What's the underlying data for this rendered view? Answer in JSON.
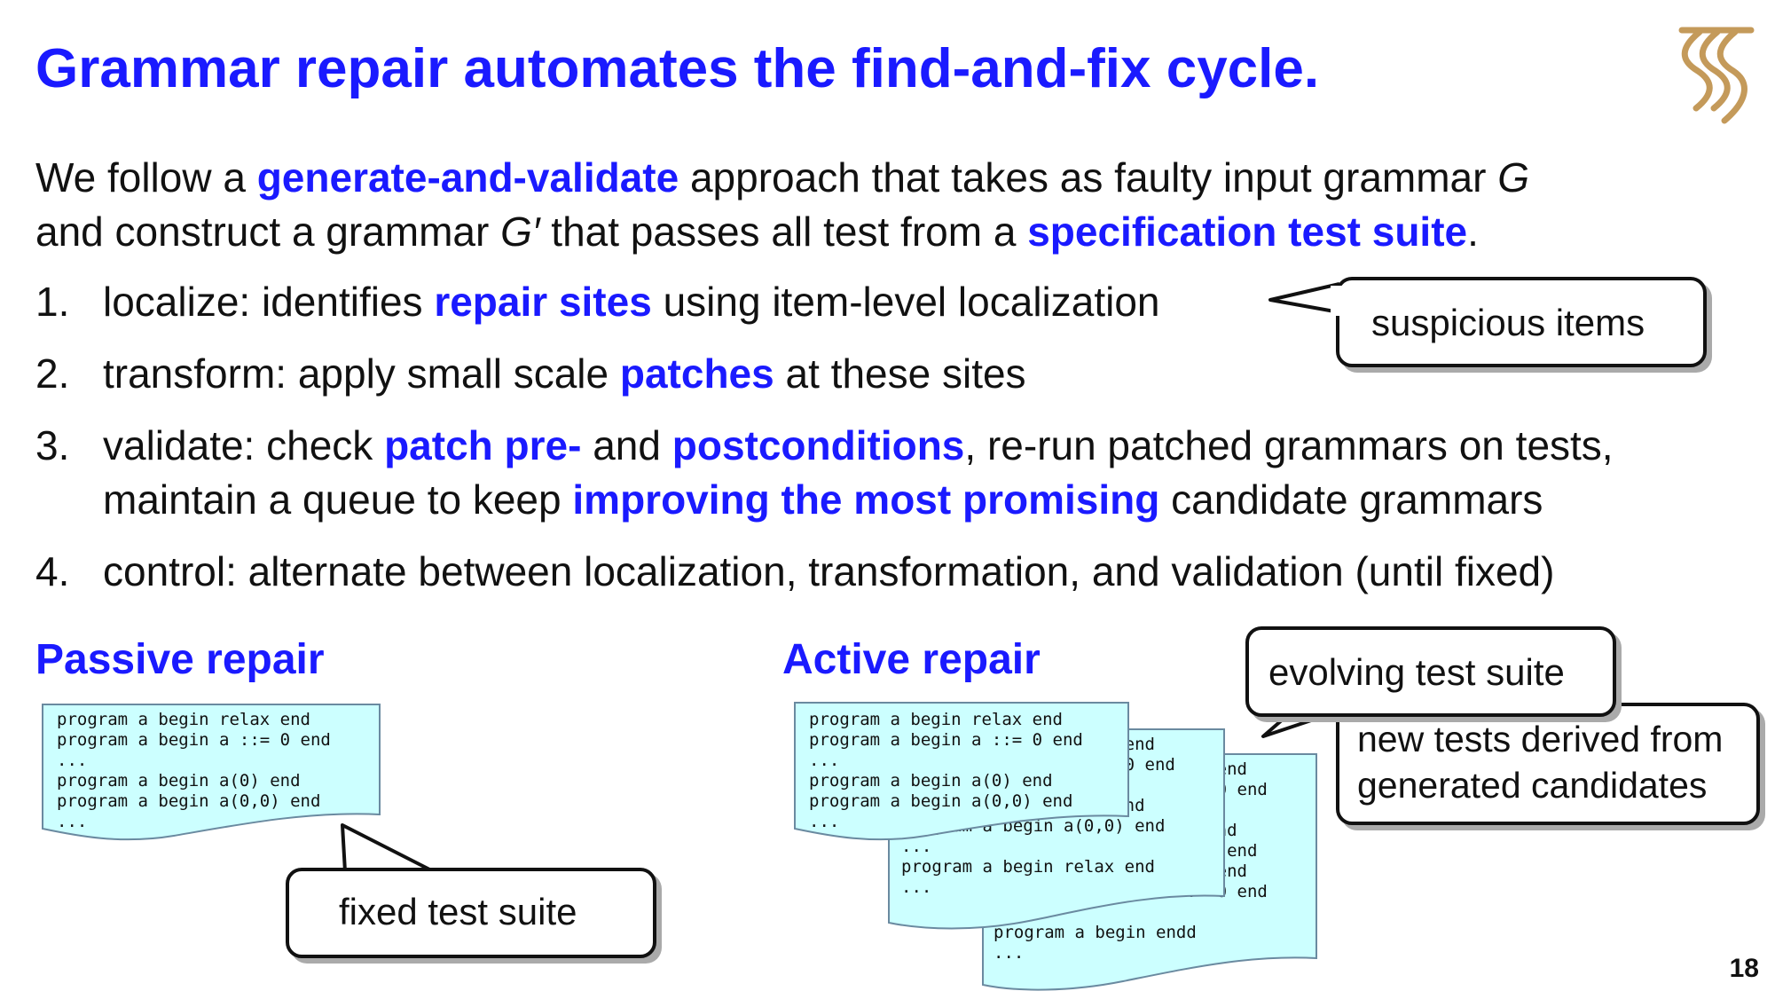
{
  "title": "Grammar repair automates the find-and-fix cycle.",
  "intro": {
    "p1": "We follow a ",
    "h1": "generate-and-validate",
    "p2": " approach that takes as faulty input grammar ",
    "g": "G",
    "p3": "and construct a grammar ",
    "gprime": "G′",
    "p4": " that passes all test from a ",
    "h2": "specification test suite",
    "p5": "."
  },
  "steps": [
    {
      "num": "1.",
      "a": "localize: identifies ",
      "h": "repair sites",
      "b": " using item-level localization"
    },
    {
      "num": "2.",
      "a": "transform: apply small scale ",
      "h": "patches",
      "b": " at these sites"
    },
    {
      "num": "3.",
      "a": "validate: check ",
      "h": "patch pre-",
      "b": " and ",
      "h2": "postconditions",
      "c": ", re-run patched grammars on tests,",
      "line2a": "maintain a queue to keep ",
      "line2h": "improving the most promising",
      "line2b": " candidate grammars"
    },
    {
      "num": "4.",
      "a": "control: alternate between localization, transformation, and validation (until fixed)"
    }
  ],
  "callouts": {
    "suspicious": "suspicious items",
    "fixed": "fixed test suite",
    "evolving": "evolving test suite",
    "new_tests_1": "new tests derived from",
    "new_tests_2": "generated candidates"
  },
  "passive": {
    "heading": "Passive repair",
    "code": "program a begin relax end\nprogram a begin a ::= 0 end\n...\nprogram a begin a(0) end\nprogram a begin a(0,0) end\n..."
  },
  "active": {
    "heading": "Active repair",
    "doc1": "program a begin relax end\nprogram a begin a ::= 0 end\n...\nprogram a begin a(0) end\nprogram a begin a(0,0) end\n...",
    "doc2": "program a begin relax end\nprogram a begin a ::= 0 end\n...\nprogram a begin a(0) end\nprogram a begin a(0,0) end\n...\nprogram a begin relax end\n...",
    "doc3": "program a begin relax end\nprogram a begin a ::= 0 end\n...\nprogram a begin a(0) end\nprogram a begin a(0,0) end\nprogram a begin relax end\nprogram a begin a ::= 0 end\n...\nprogram a begin endd\n..."
  },
  "page_number": "18",
  "colors": {
    "accent": "#1a1aff",
    "doc_fill": "#ccffff",
    "logo": "#c49a5a"
  }
}
